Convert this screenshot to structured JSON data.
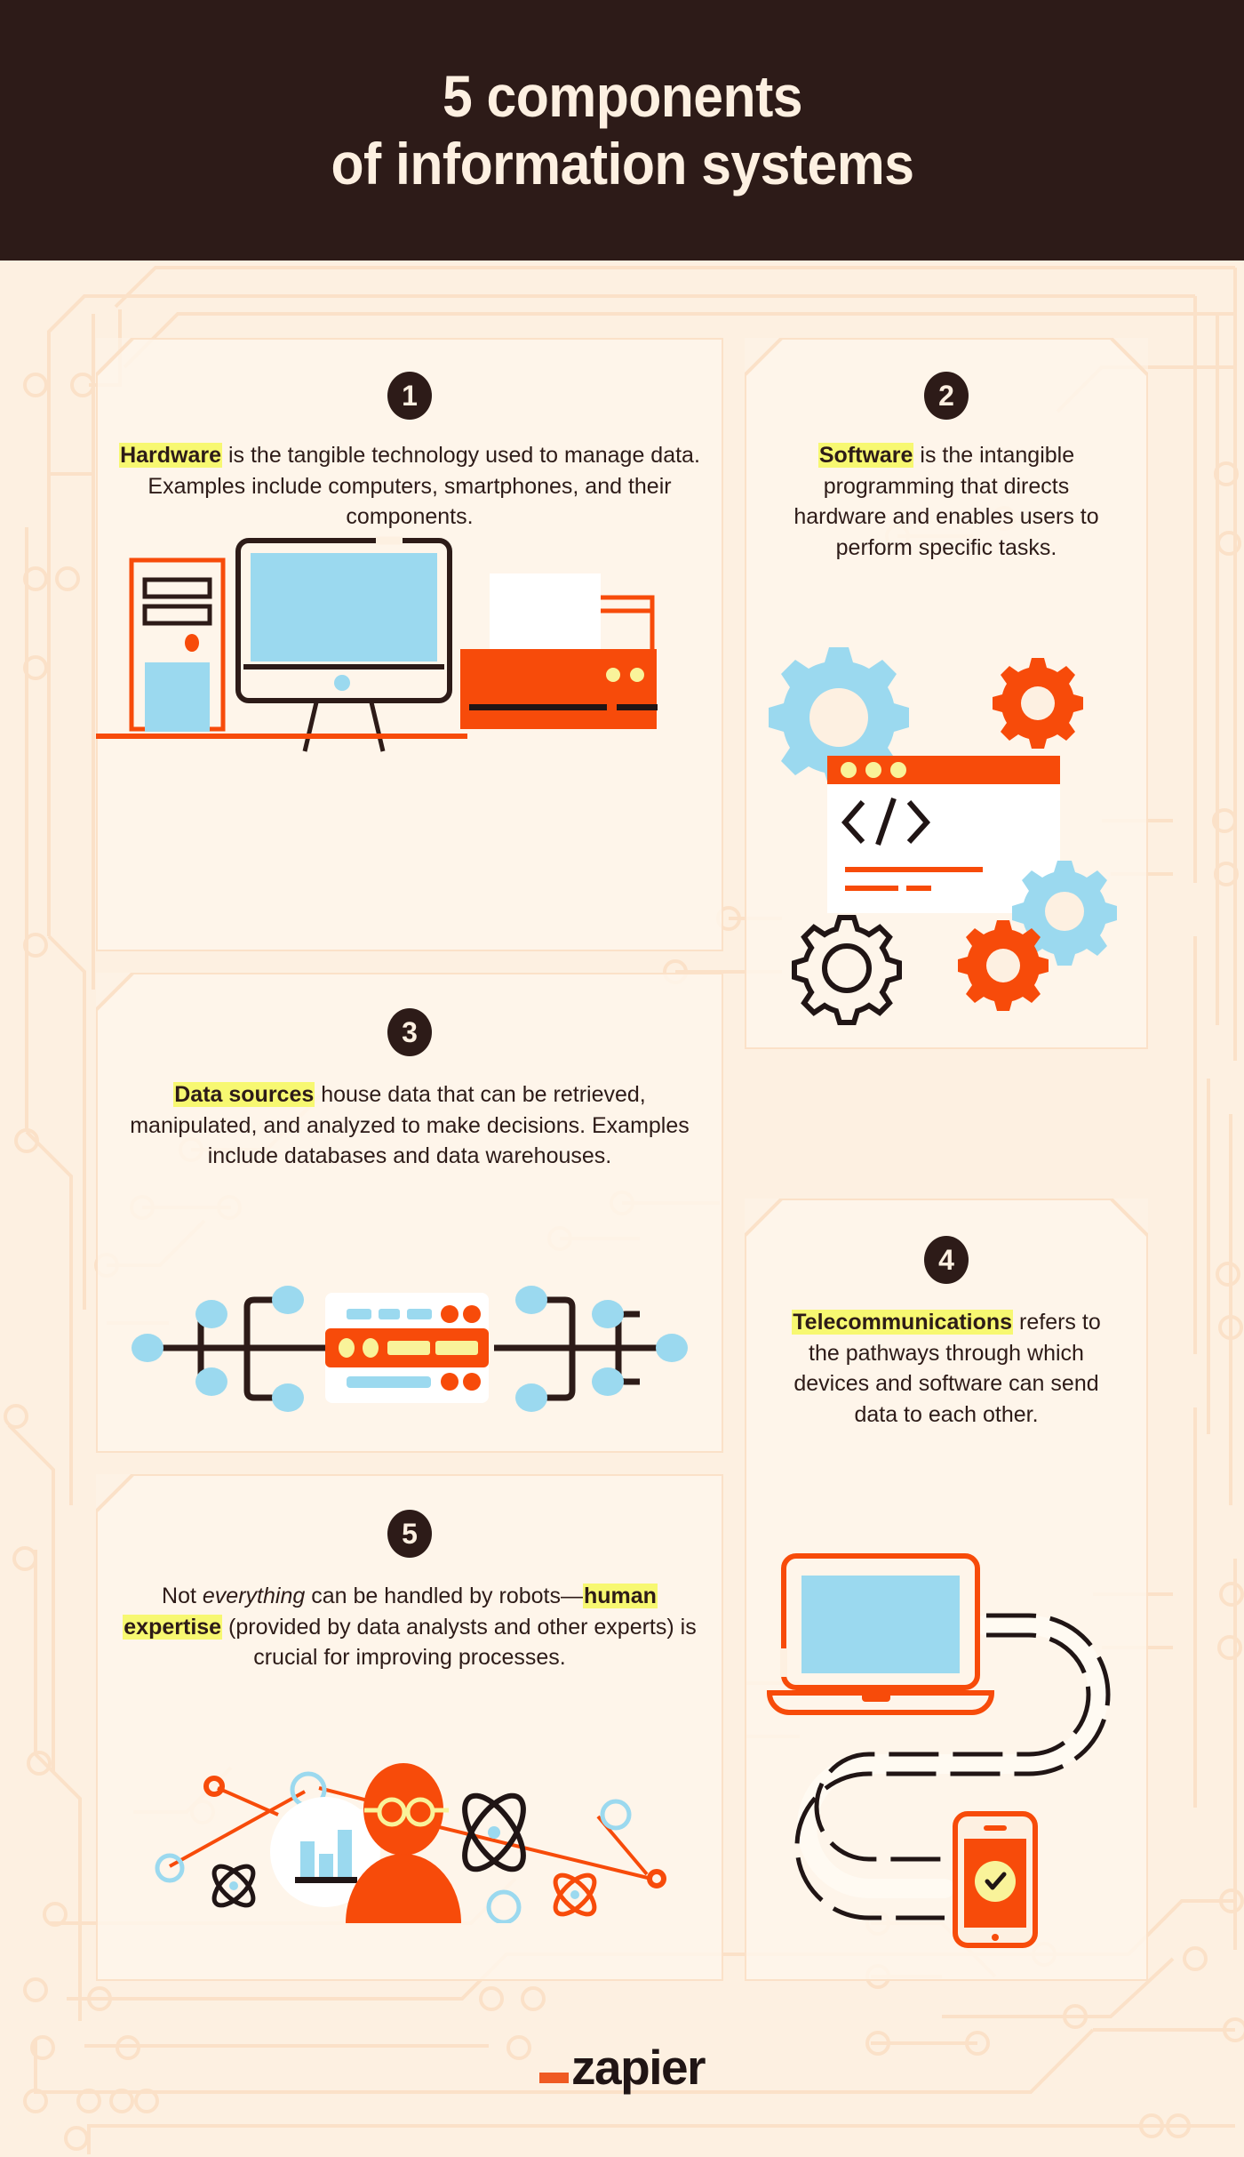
{
  "header": {
    "title": "5 components\nof information systems"
  },
  "palette": {
    "background": "#fdf0e1",
    "header_bg": "#2d1b18",
    "orange": "#f74b0a",
    "orange_alt": "#ef5a23",
    "blue": "#9bd9ef",
    "yellow": "#f9f39a",
    "highlight_yellow": "#f7f871",
    "dark": "#2d1b18",
    "white": "#ffffff",
    "circuit_line": "#fbe1c8"
  },
  "cards": [
    {
      "number": "1",
      "term": "Hardware",
      "text_before": "",
      "text_after": " is the tangible technology used to manage data. Examples include computers, smartphones, and their components.",
      "illustration": "desktop-computer-tower-printer-illustration"
    },
    {
      "number": "2",
      "term": "Software",
      "text_before": "",
      "text_after": " is the intangible programming that directs hardware and enables users to perform specific tasks.",
      "illustration": "code-window-gears-illustration"
    },
    {
      "number": "3",
      "term": "Data sources",
      "text_before": "",
      "text_after": " house data that can be retrieved, manipulated, and analyzed to make decisions. Examples include databases and data warehouses.",
      "illustration": "server-network-nodes-illustration"
    },
    {
      "number": "4",
      "term": "Telecommunications",
      "text_before": "",
      "text_after": " refers to the pathways through which devices and software can send data to each other.",
      "illustration": "laptop-phone-cable-illustration"
    },
    {
      "number": "5",
      "term": "human expertise",
      "text_before": "Not ",
      "text_italic": "everything",
      "text_middle": " can be handled by robots—",
      "text_after": " (provided by data analysts and other experts) is crucial for improving processes.",
      "illustration": "data-analyst-network-illustration"
    }
  ],
  "illustration_labels": {
    "code_snippet": "</>",
    "checkmark": "✓"
  },
  "footer": {
    "logo_text": "zapier",
    "logo_mark": "underscore-dash"
  }
}
